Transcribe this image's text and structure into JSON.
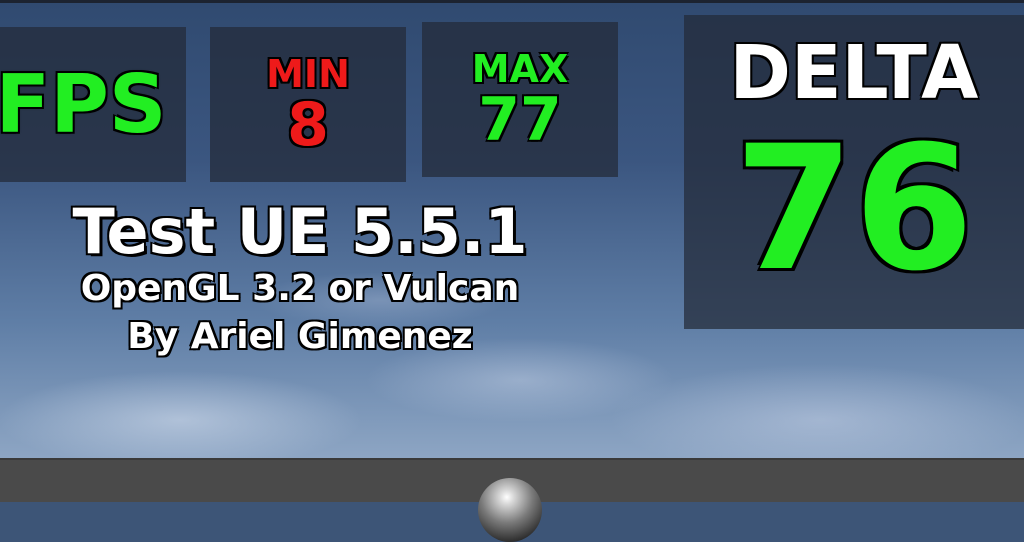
{
  "hud": {
    "fps_label": "FPS",
    "min_label": "MIN",
    "min_value": "8",
    "max_label": "MAX",
    "max_value": "77",
    "delta_label": "DELTA",
    "delta_value": "76"
  },
  "info": {
    "title": "Test UE 5.5.1",
    "subtitle": "OpenGL 3.2 or Vulcan",
    "author": "By Ariel Gimenez"
  },
  "colors": {
    "good": "#22ee22",
    "bad": "#ee1a1a",
    "panel": "#232a38"
  }
}
